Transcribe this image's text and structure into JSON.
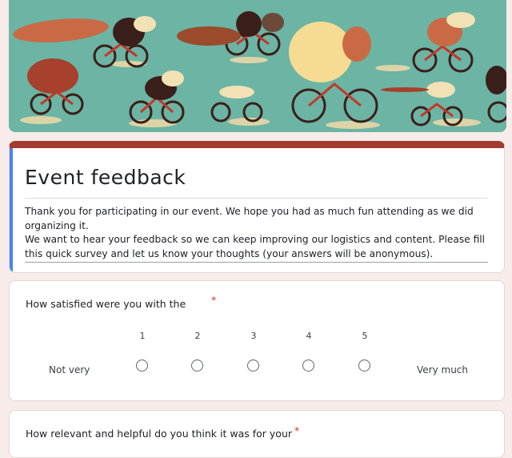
{
  "form": {
    "title": "Event feedback",
    "description": "Thank you for participating in our event. We hope you had as much fun attending as we did organizing it.\nWe want to hear your feedback so we can keep improving our logistics and content. Please fill this quick survey and let us know your thoughts (your answers will be anonymous)."
  },
  "questions": [
    {
      "title": "How satisfied were you with the",
      "required_mark": "*",
      "scale": [
        "1",
        "2",
        "3",
        "4",
        "5"
      ],
      "low_label": "Not very",
      "high_label": "Very much"
    },
    {
      "title": "How relevant and helpful do you think it was for your",
      "required_mark": "*"
    }
  ],
  "colors": {
    "header_top": "#a33b2f",
    "accent": "#4285f4",
    "banner_bg": "#6cb4a4",
    "required": "#d93025"
  },
  "banner": {
    "icon": "cycling-animals-illustration"
  }
}
